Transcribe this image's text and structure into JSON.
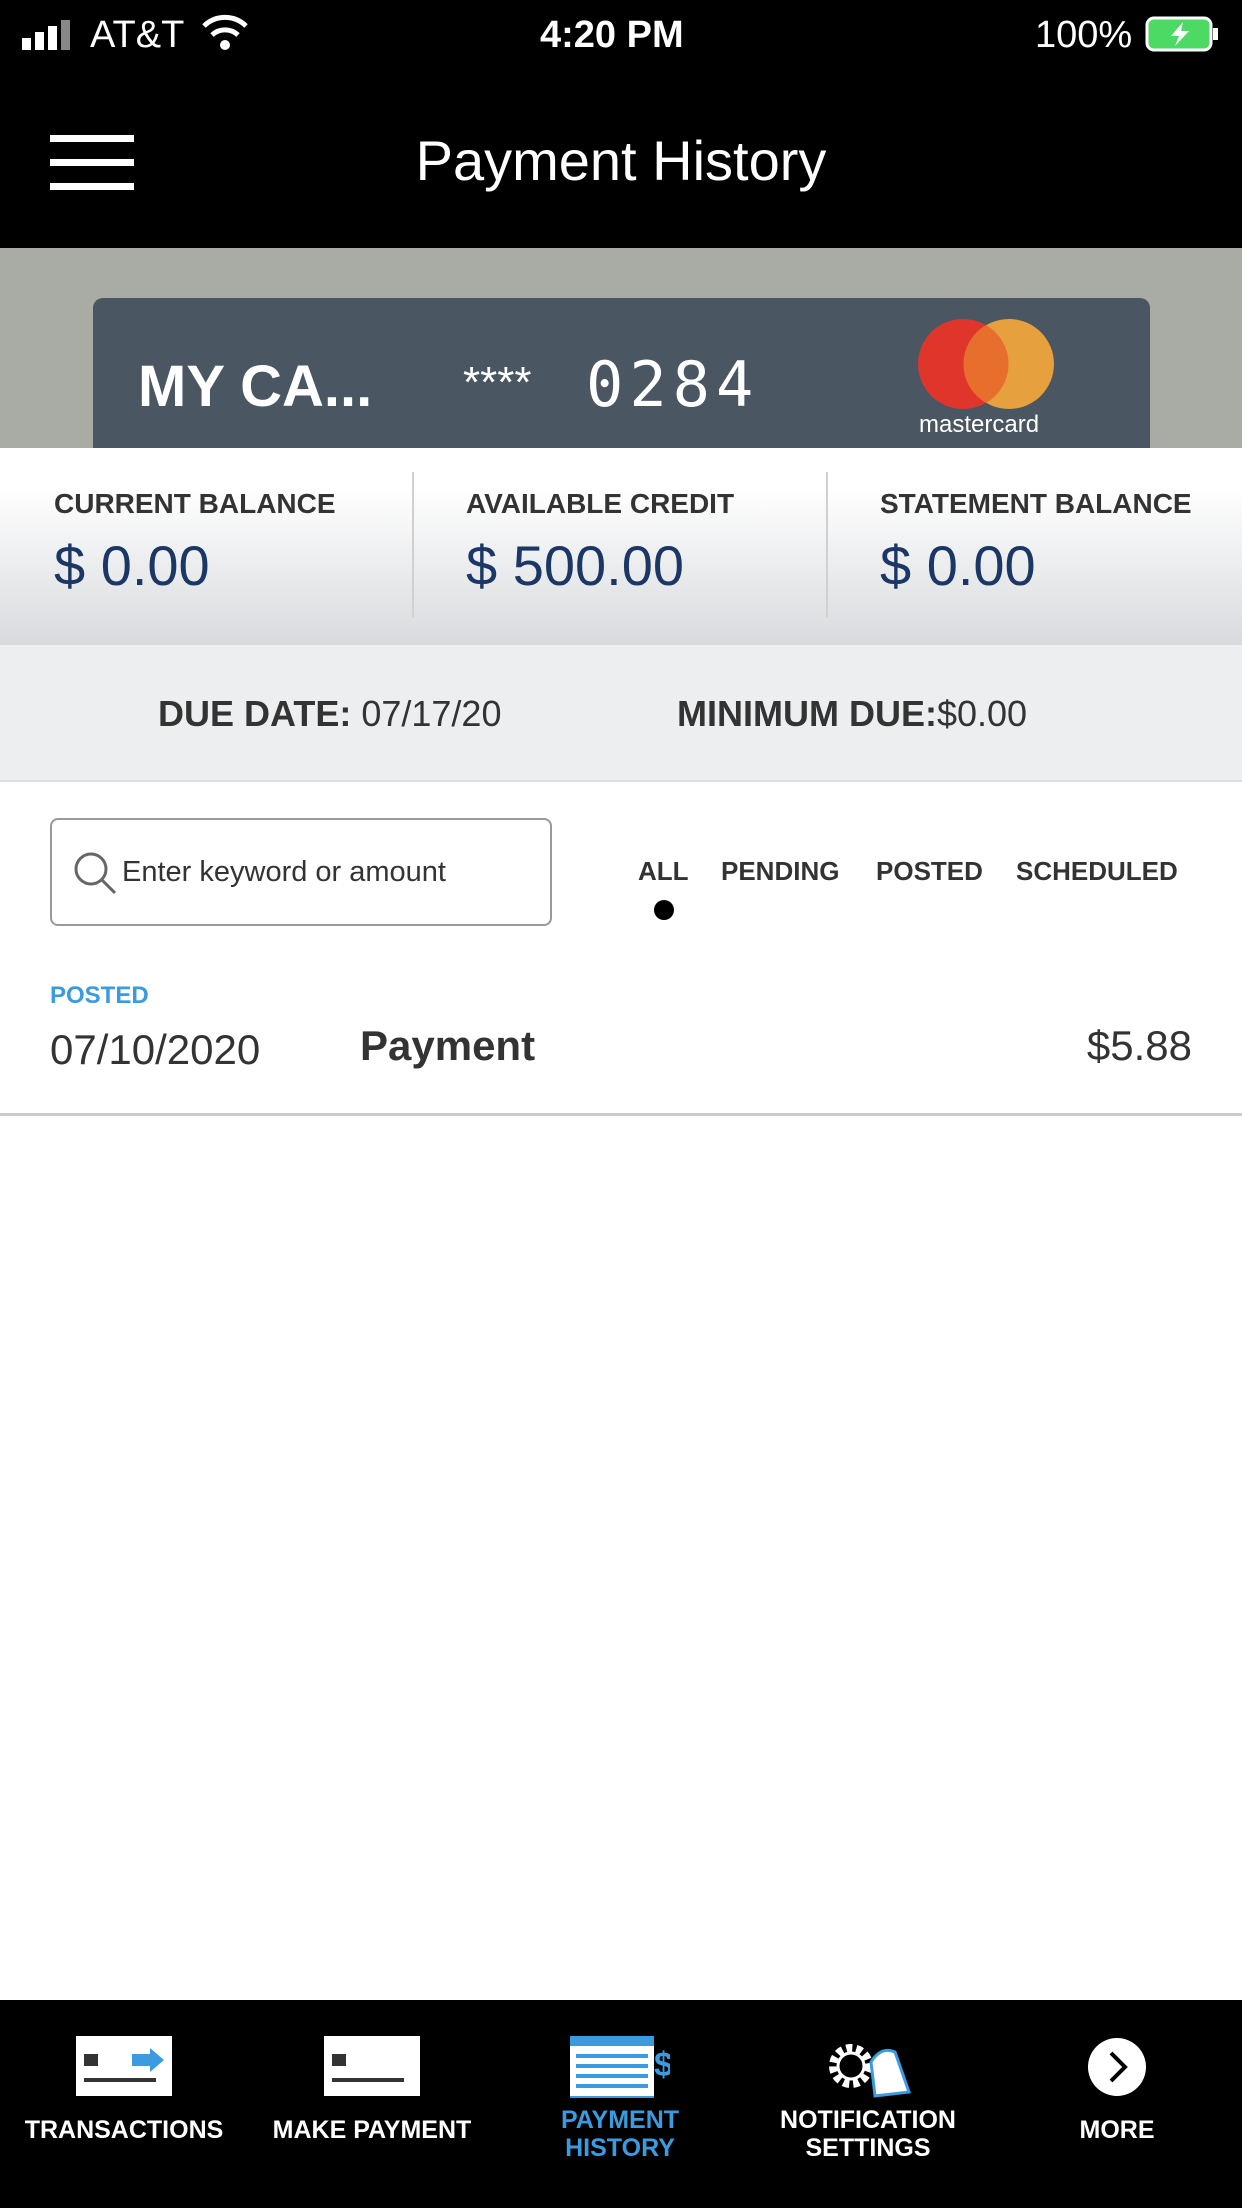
{
  "status": {
    "carrier": "AT&T",
    "time": "4:20 PM",
    "battery": "100%"
  },
  "header": {
    "title": "Payment History",
    "menu_icon": "hamburger-icon"
  },
  "card": {
    "name": "MY CA...",
    "mask": "****",
    "last4": "0284",
    "brand": "mastercard",
    "brand_colors": [
      "#e0352b",
      "#eea43c"
    ]
  },
  "balances": [
    {
      "label": "CURRENT BALANCE",
      "value": "$ 0.00"
    },
    {
      "label": "AVAILABLE CREDIT",
      "value": "$ 500.00"
    },
    {
      "label": "STATEMENT BALANCE",
      "value": "$ 0.00"
    }
  ],
  "due": {
    "date_label": "DUE DATE:",
    "date": "07/17/20",
    "min_label": "MINIMUM DUE:",
    "min": "$0.00"
  },
  "search": {
    "placeholder": "Enter keyword or amount",
    "value": ""
  },
  "filters": {
    "tabs": [
      "ALL",
      "PENDING",
      "POSTED",
      "SCHEDULED"
    ],
    "selected": "ALL"
  },
  "transactions": [
    {
      "status": "POSTED",
      "date": "07/10/2020",
      "description": "Payment",
      "amount": "$5.88"
    }
  ],
  "bottom_nav": [
    {
      "label": "TRANSACTIONS",
      "icon": "transactions-icon"
    },
    {
      "label": "MAKE PAYMENT",
      "icon": "make-payment-icon"
    },
    {
      "label": "PAYMENT HISTORY",
      "icon": "calendar-dollar-icon",
      "active": true
    },
    {
      "label": "NOTIFICATION SETTINGS",
      "icon": "gear-bell-icon"
    },
    {
      "label": "MORE",
      "icon": "chevron-right-circle-icon"
    }
  ],
  "colors": {
    "accent": "#3a9be0",
    "balance": "#1b3766"
  }
}
